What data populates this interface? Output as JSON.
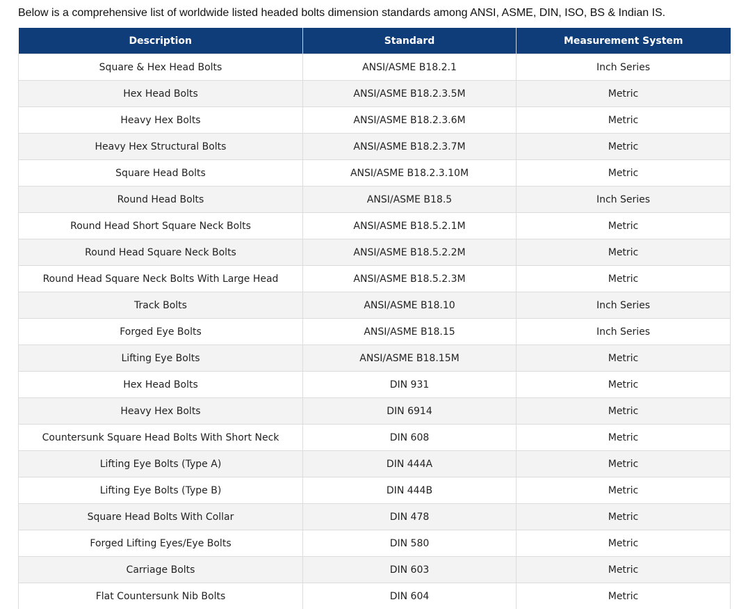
{
  "intro": "Below is a comprehensive list of worldwide listed headed bolts dimension standards among ANSI, ASME, DIN, ISO, BS & Indian IS.",
  "table": {
    "headers": [
      "Description",
      "Standard",
      "Measurement System"
    ],
    "rows": [
      [
        "Square & Hex Head Bolts",
        "ANSI/ASME B18.2.1",
        "Inch Series"
      ],
      [
        "Hex Head Bolts",
        "ANSI/ASME B18.2.3.5M",
        "Metric"
      ],
      [
        "Heavy Hex Bolts",
        "ANSI/ASME B18.2.3.6M",
        "Metric"
      ],
      [
        "Heavy Hex Structural Bolts",
        "ANSI/ASME B18.2.3.7M",
        "Metric"
      ],
      [
        "Square Head Bolts",
        "ANSI/ASME B18.2.3.10M",
        "Metric"
      ],
      [
        "Round Head Bolts",
        "ANSI/ASME B18.5",
        "Inch Series"
      ],
      [
        "Round Head Short Square Neck Bolts",
        "ANSI/ASME B18.5.2.1M",
        "Metric"
      ],
      [
        "Round Head Square Neck Bolts",
        "ANSI/ASME B18.5.2.2M",
        "Metric"
      ],
      [
        "Round Head Square Neck Bolts With Large Head",
        "ANSI/ASME B18.5.2.3M",
        "Metric"
      ],
      [
        "Track Bolts",
        "ANSI/ASME B18.10",
        "Inch Series"
      ],
      [
        "Forged Eye Bolts",
        "ANSI/ASME B18.15",
        "Inch Series"
      ],
      [
        "Lifting Eye Bolts",
        "ANSI/ASME B18.15M",
        "Metric"
      ],
      [
        "Hex Head Bolts",
        "DIN 931",
        "Metric"
      ],
      [
        "Heavy Hex Bolts",
        "DIN 6914",
        "Metric"
      ],
      [
        "Countersunk Square Head Bolts With Short Neck",
        "DIN 608",
        "Metric"
      ],
      [
        "Lifting Eye Bolts (Type A)",
        "DIN 444A",
        "Metric"
      ],
      [
        "Lifting Eye Bolts (Type B)",
        "DIN 444B",
        "Metric"
      ],
      [
        "Square Head Bolts With Collar",
        "DIN 478",
        "Metric"
      ],
      [
        "Forged Lifting Eyes/Eye Bolts",
        "DIN 580",
        "Metric"
      ],
      [
        "Carriage Bolts",
        "DIN 603",
        "Metric"
      ],
      [
        "Flat Countersunk Nib Bolts",
        "DIN 604",
        "Metric"
      ],
      [
        "",
        "",
        ""
      ]
    ]
  },
  "colors": {
    "header_bg": "#0e3d7a",
    "header_text": "#ffffff",
    "row_alt_bg": "#f3f3f3",
    "border": "#dcdcdc"
  }
}
